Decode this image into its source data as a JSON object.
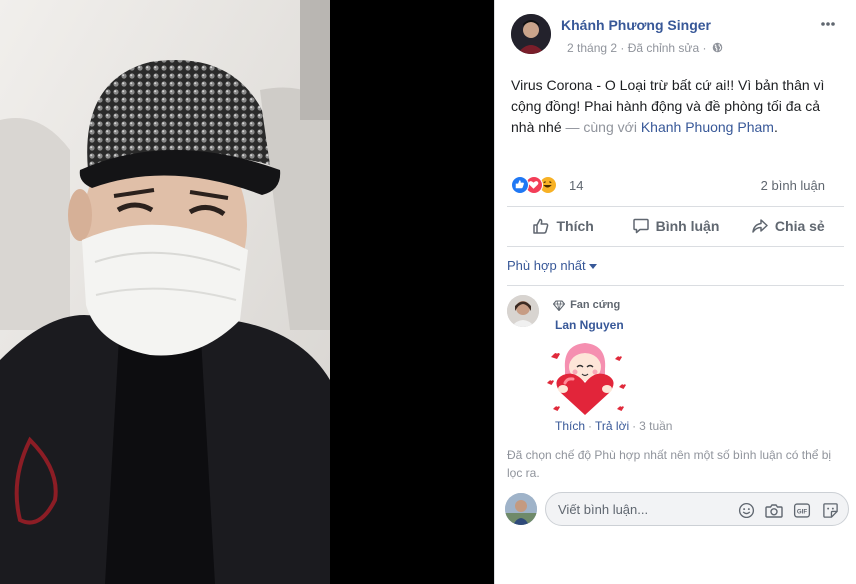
{
  "post": {
    "author": "Khánh Phương Singer",
    "date": "2 tháng 2",
    "edited": "Đã chỉnh sửa",
    "text": "Virus Corona - O Loại trừ bất cứ ai!! Vì bản thân vì cộng đồng! Phai hành động và đề phòng tối đa cả nhà nhé",
    "tag_separator": "— cùng với",
    "tagged": "Khanh Phuong Pham",
    "reaction_count": "14",
    "comment_count": "2 bình luận",
    "privacy_icon": "globe-icon",
    "menu_icon": "more-horizontal-icon"
  },
  "actions": {
    "like": "Thích",
    "comment": "Bình luận",
    "share": "Chia sẻ"
  },
  "sort": {
    "label": "Phù hợp nhất"
  },
  "comment": {
    "badge": "Fan cứng",
    "name": "Lan Nguyen",
    "like": "Thích",
    "reply": "Trả lời",
    "time": "3 tuần"
  },
  "filter_note": "Đã chọn chế độ Phù hợp nhất nên một số bình luận có thể bị lọc ra.",
  "composer": {
    "placeholder": "Viết bình luận...",
    "icons": [
      "emoji-icon",
      "camera-icon",
      "gif-icon",
      "sticker-icon"
    ]
  },
  "colors": {
    "link": "#385898",
    "meta": "#90949c",
    "like_blue": "#2078f4",
    "love_red": "#f33e58",
    "haha_yellow": "#f7b125"
  }
}
